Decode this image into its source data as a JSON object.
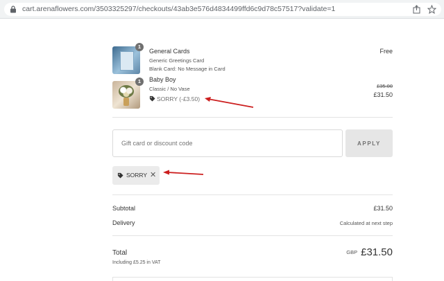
{
  "browser": {
    "url": "cart.arenaflowers.com/3503325297/checkouts/43ab3e576d4834499ffd6c9d78c57517?validate=1"
  },
  "items": [
    {
      "quantity": "1",
      "name": "General Cards",
      "lines": [
        "Generic Greetings Card",
        "Blank Card: No Message in Card"
      ],
      "price": "Free"
    },
    {
      "quantity": "1",
      "name": "Baby Boy",
      "lines": [
        "Classic / No Vase"
      ],
      "original_price": "£35.00",
      "price": "£31.50",
      "discount_text": "SORRY (-£3.50)"
    }
  ],
  "discount": {
    "placeholder": "Gift card or discount code",
    "apply_label": "APPLY",
    "applied_code": "SORRY"
  },
  "totals": {
    "subtotal_label": "Subtotal",
    "subtotal_value": "£31.50",
    "delivery_label": "Delivery",
    "delivery_value": "Calculated at next step",
    "total_label": "Total",
    "vat_note": "Including £5.25 in VAT",
    "currency": "GBP",
    "total_value": "£31.50"
  },
  "colors": {
    "annotation_arrow": "#cc1f1f",
    "button_bg": "#e6e6e6",
    "chip_bg": "#ebebeb"
  }
}
